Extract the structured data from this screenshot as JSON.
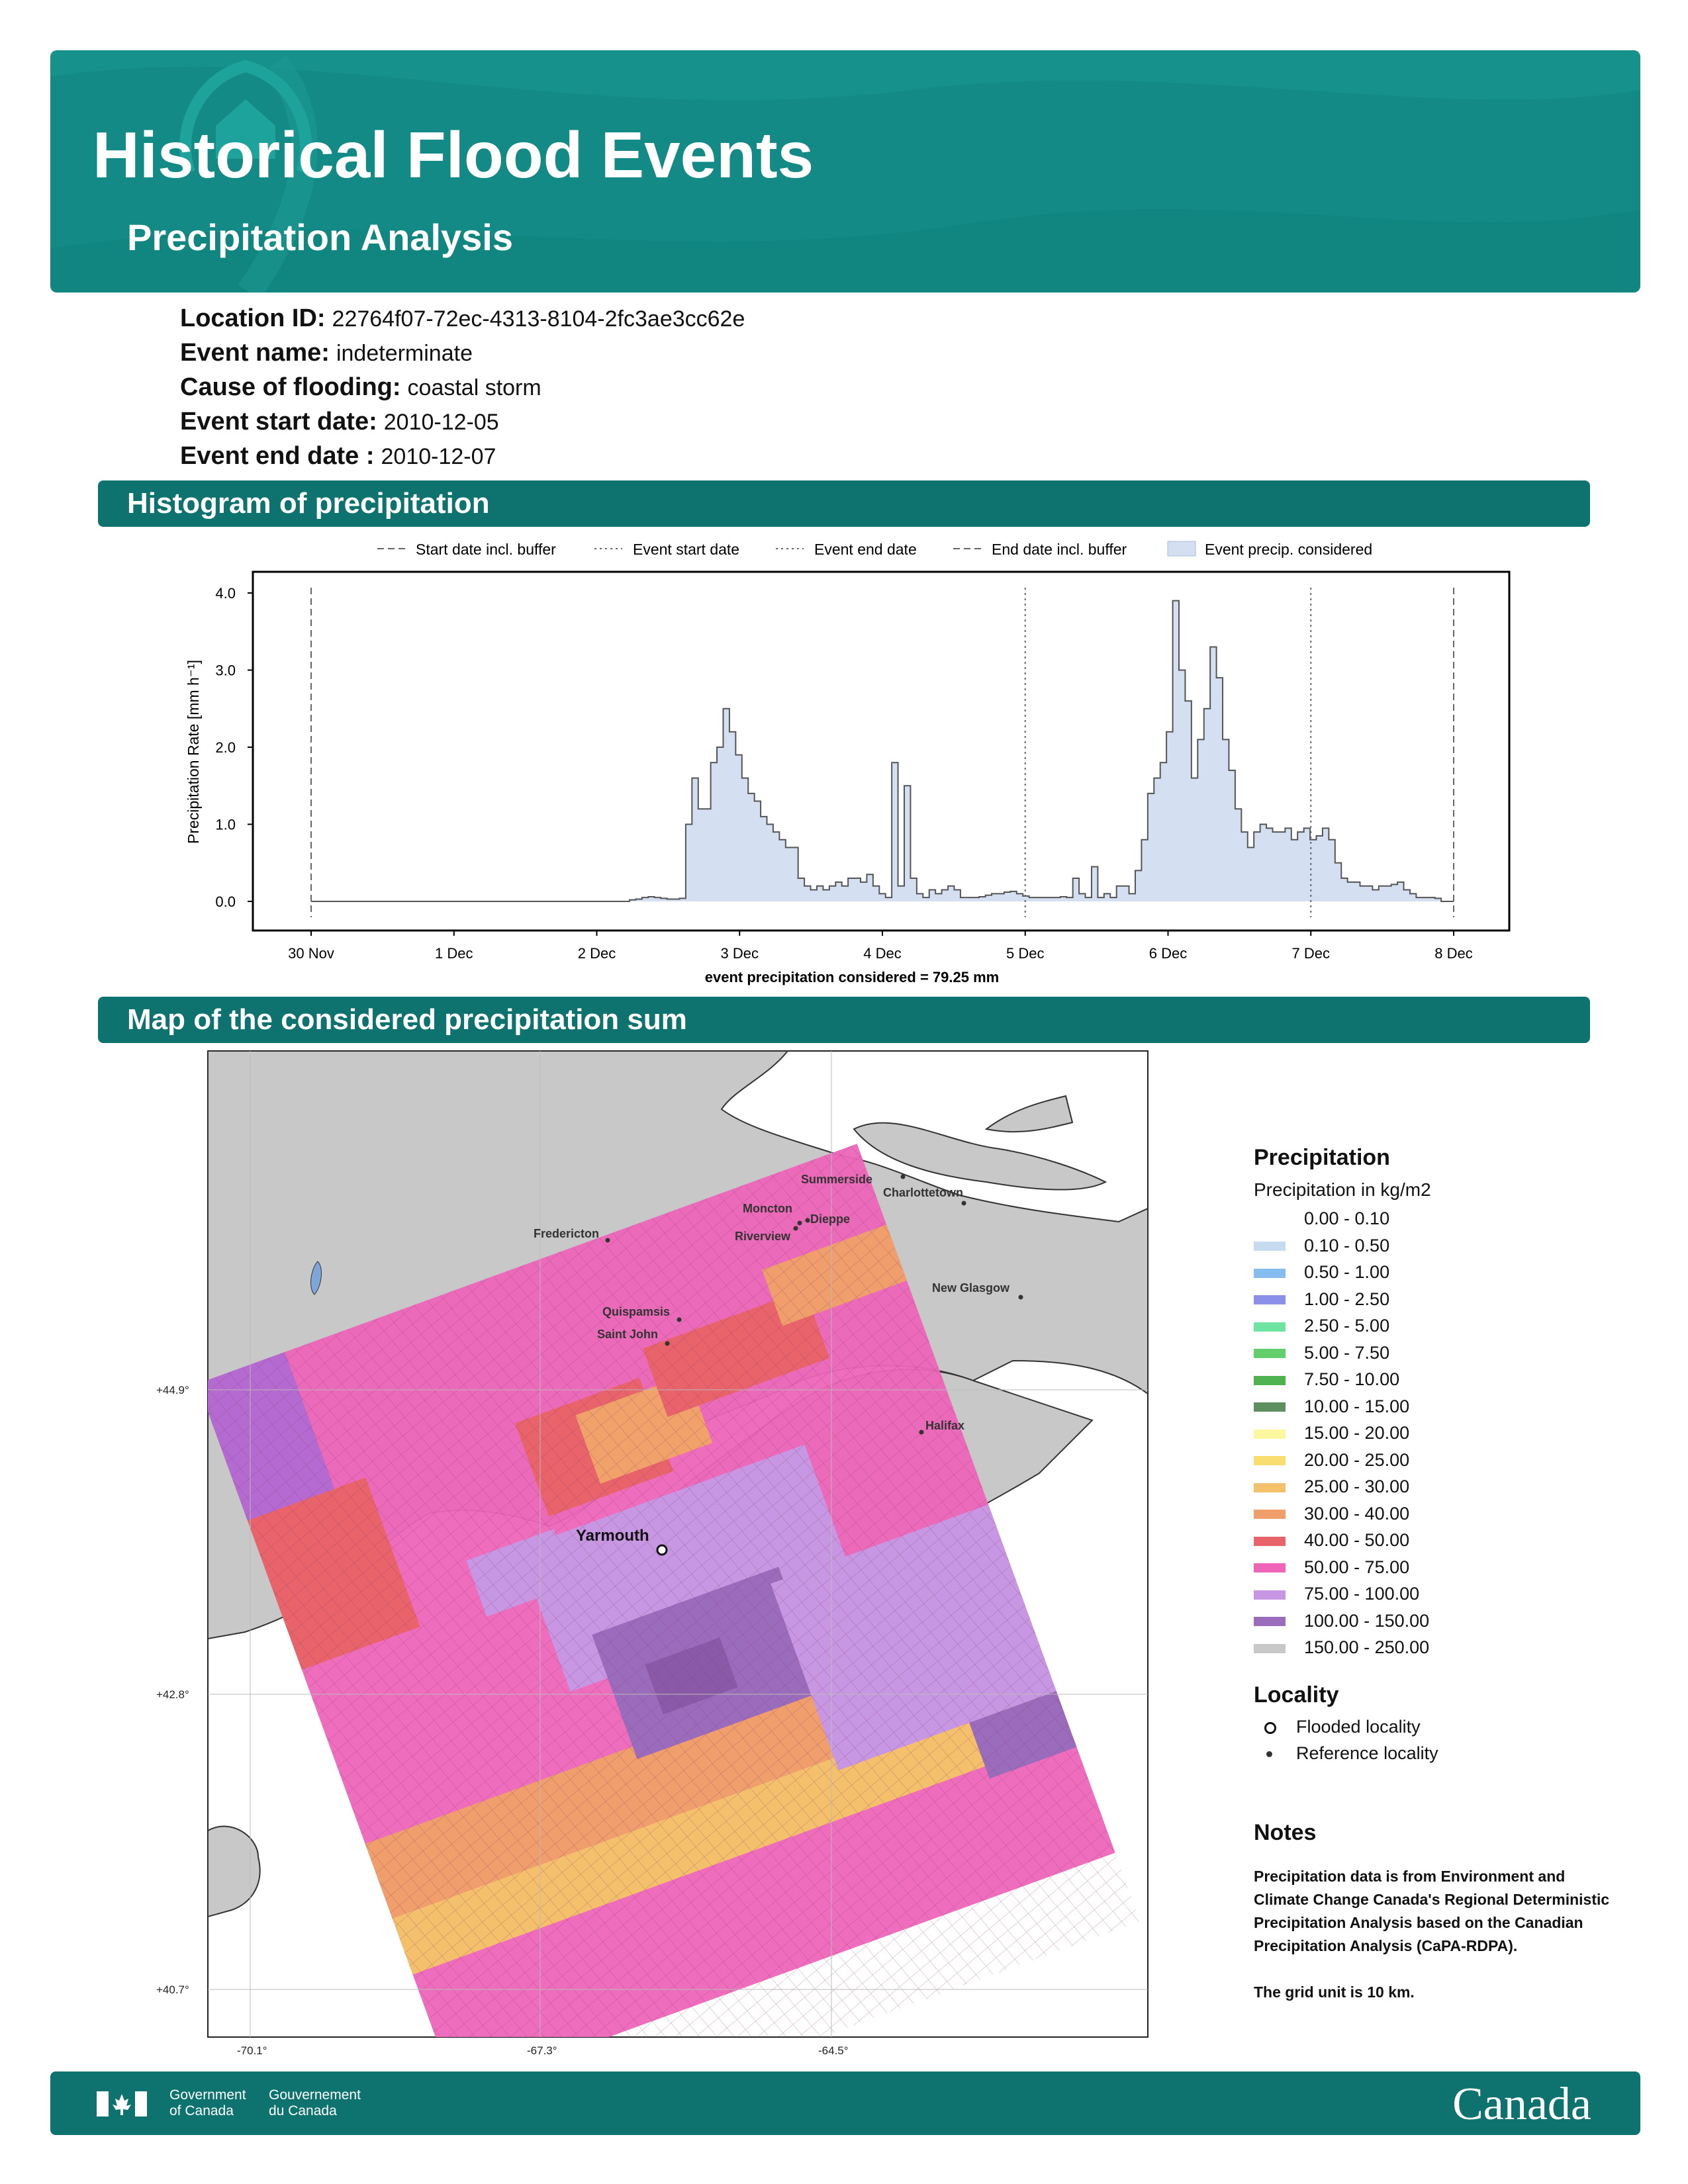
{
  "header": {
    "title": "Historical Flood Events",
    "subtitle": "Precipitation Analysis"
  },
  "info": [
    {
      "label": "Location ID:",
      "value": "22764f07-72ec-4313-8104-2fc3ae3cc62e"
    },
    {
      "label": "Event name:",
      "value": "indeterminate"
    },
    {
      "label": "Cause of flooding:",
      "value": "coastal storm"
    },
    {
      "label": "Event start date:",
      "value": "2010-12-05"
    },
    {
      "label": "Event end date :",
      "value": "2010-12-07"
    }
  ],
  "histogram_section": {
    "title": "Histogram of precipitation"
  },
  "map_section": {
    "title": "Map of the considered precipitation sum"
  },
  "chart_data": {
    "type": "bar",
    "ylabel": "Precipitation Rate [mm h⁻¹]",
    "xlabel": "event precipitation considered = 79.25 mm",
    "ylim": [
      0,
      4.0
    ],
    "xlim_days": [
      0,
      8
    ],
    "x_ticks": [
      "30 Nov",
      "1 Dec",
      "2 Dec",
      "3 Dec",
      "4 Dec",
      "5 Dec",
      "6 Dec",
      "7 Dec",
      "8 Dec"
    ],
    "y_ticks": [
      "0.0",
      "1.0",
      "2.0",
      "3.0",
      "4.0"
    ],
    "legend": [
      "Start date incl. buffer",
      "Event start date",
      "Event end date",
      "End date incl. buffer",
      "Event precip. considered"
    ],
    "markers": {
      "start_buffer": "30 Nov",
      "event_start": "5 Dec",
      "event_end": "7 Dec",
      "end_buffer": "8 Dec"
    },
    "bar_color": "#d4e0f2",
    "step_color": "#555555",
    "values": [
      0,
      0,
      0,
      0,
      0,
      0,
      0,
      0,
      0,
      0,
      0,
      0,
      0,
      0,
      0,
      0,
      0,
      0,
      0,
      0,
      0,
      0,
      0,
      0,
      0,
      0,
      0,
      0,
      0,
      0,
      0,
      0,
      0,
      0,
      0,
      0,
      0,
      0,
      0,
      0,
      0,
      0,
      0,
      0,
      0,
      0,
      0,
      0,
      0,
      0,
      0,
      0.02,
      0.03,
      0.05,
      0.06,
      0.05,
      0.04,
      0.03,
      0.03,
      0.04,
      1.0,
      1.6,
      1.2,
      1.2,
      1.8,
      2.0,
      2.5,
      2.2,
      1.9,
      1.6,
      1.4,
      1.3,
      1.1,
      1.0,
      0.9,
      0.8,
      0.7,
      0.7,
      0.3,
      0.2,
      0.15,
      0.2,
      0.15,
      0.2,
      0.25,
      0.2,
      0.3,
      0.3,
      0.25,
      0.35,
      0.2,
      0.1,
      0.05,
      1.8,
      0.2,
      1.5,
      0.3,
      0.1,
      0.05,
      0.15,
      0.1,
      0.15,
      0.2,
      0.15,
      0.05,
      0.05,
      0.05,
      0.06,
      0.08,
      0.1,
      0.1,
      0.12,
      0.13,
      0.1,
      0.07,
      0.05,
      0.05,
      0.05,
      0.05,
      0.05,
      0.06,
      0.05,
      0.3,
      0.1,
      0.05,
      0.45,
      0.05,
      0.1,
      0.05,
      0.2,
      0.2,
      0.1,
      0.4,
      0.8,
      1.4,
      1.6,
      1.8,
      2.2,
      3.9,
      3.0,
      2.6,
      1.6,
      2.1,
      2.5,
      3.3,
      2.9,
      2.1,
      1.7,
      1.2,
      0.9,
      0.7,
      0.9,
      1.0,
      0.95,
      0.9,
      0.9,
      0.95,
      0.8,
      0.9,
      0.95,
      0.8,
      0.85,
      0.95,
      0.8,
      0.5,
      0.3,
      0.25,
      0.25,
      0.2,
      0.2,
      0.15,
      0.2,
      0.2,
      0.22,
      0.25,
      0.15,
      0.1,
      0.05,
      0.05,
      0.05,
      0.04,
      0,
      0
    ]
  },
  "map": {
    "lat_labels": [
      "+44.9°",
      "+42.8°",
      "+40.7°"
    ],
    "lon_labels": [
      "-70.1°",
      "-67.3°",
      "-64.5°"
    ],
    "flooded_locality": "Yarmouth",
    "reference_localities": [
      "Summerside",
      "Charlottetown",
      "Moncton",
      "Dieppe",
      "Riverview",
      "Fredericton",
      "New Glasgow",
      "Quispamsis",
      "Saint John",
      "Halifax"
    ]
  },
  "legend": {
    "precip_title": "Precipitation",
    "precip_subtitle": "Precipitation in kg/m2",
    "classes": [
      {
        "label": "0.00 - 0.10",
        "color": "#ffffff"
      },
      {
        "label": "0.10 - 0.50",
        "color": "#c6dbf0"
      },
      {
        "label": "0.50 - 1.00",
        "color": "#86bdf0"
      },
      {
        "label": "1.00 - 2.50",
        "color": "#8a8fe8"
      },
      {
        "label": "2.50 - 5.00",
        "color": "#6fe3a2"
      },
      {
        "label": "5.00 - 7.50",
        "color": "#62cf6c"
      },
      {
        "label": "7.50 - 10.00",
        "color": "#4fb34f"
      },
      {
        "label": "10.00 - 15.00",
        "color": "#5e8f5e"
      },
      {
        "label": "15.00 - 20.00",
        "color": "#fdf7a0"
      },
      {
        "label": "20.00 - 25.00",
        "color": "#f9dd6e"
      },
      {
        "label": "25.00 - 30.00",
        "color": "#f5c06b"
      },
      {
        "label": "30.00 - 40.00",
        "color": "#ef9e6c"
      },
      {
        "label": "40.00 - 50.00",
        "color": "#e9636a"
      },
      {
        "label": "50.00 - 75.00",
        "color": "#ee65b9"
      },
      {
        "label": "75.00 - 100.00",
        "color": "#c797e3"
      },
      {
        "label": "100.00 - 150.00",
        "color": "#9b6cbc"
      },
      {
        "label": "150.00 - 250.00",
        "color": "#c8c8c8"
      }
    ],
    "locality_title": "Locality",
    "flooded_label": "Flooded locality",
    "reference_label": "Reference locality"
  },
  "notes": {
    "title": "Notes",
    "text1": "Precipitation data is from Environment and Climate Change Canada's Regional Deterministic Precipitation Analysis based on the Canadian Precipitation Analysis (CaPA-RDPA).",
    "text2": "The grid unit is 10 km."
  },
  "footer": {
    "gov_en": "Government of Canada",
    "gov_fr": "Gouvernement du Canada",
    "wordmark": "Canada"
  }
}
